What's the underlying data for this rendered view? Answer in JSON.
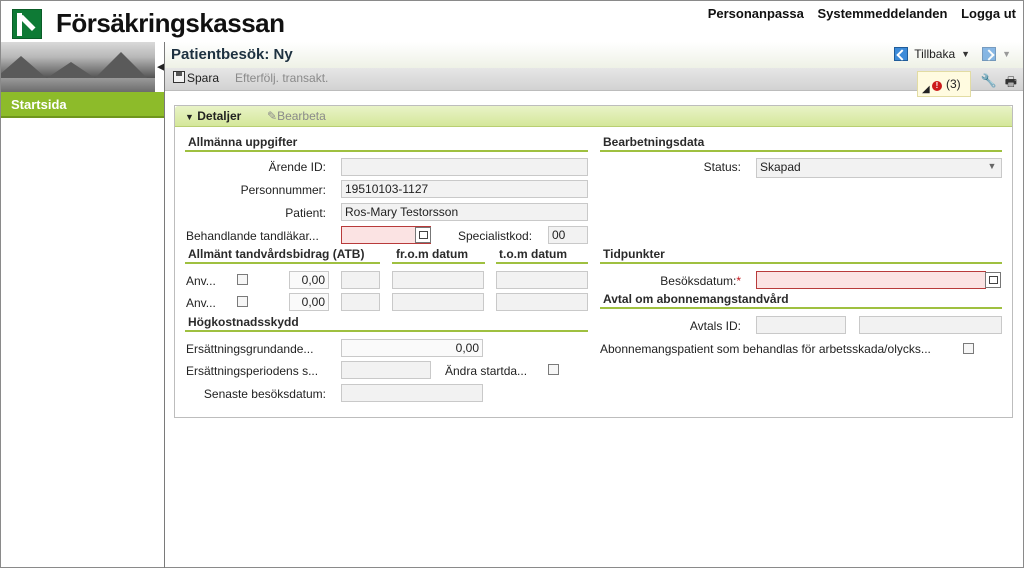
{
  "header": {
    "brand": "Försäkringskassan",
    "links": [
      "Personanpassa",
      "Systemmeddelanden",
      "Logga ut"
    ]
  },
  "sidebar": {
    "collapse_icon": "arrow-left-icon",
    "items": [
      {
        "label": "Startsida"
      }
    ]
  },
  "page": {
    "title": "Patientbesök: Ny",
    "back_label": "Tillbaka"
  },
  "toolbar": {
    "save_label": "Spara",
    "follow_label": "Efterfölj. transakt.",
    "error_count": "(3)"
  },
  "panel": {
    "details_label": "Detaljer",
    "edit_label": "Bearbeta"
  },
  "general": {
    "title": "Allmänna uppgifter",
    "case_id_label": "Ärende ID:",
    "case_id_value": "",
    "pnr_label": "Personnummer:",
    "pnr_value": "19510103-1127",
    "patient_label": "Patient:",
    "patient_value": "Ros-Mary Testorsson",
    "dentist_label": "Behandlande tandläkar...",
    "dentist_value": "",
    "specialist_label": "Specialistkod:",
    "specialist_value": "00"
  },
  "atb": {
    "title": "Allmänt tandvårdsbidrag (ATB)",
    "from_title": "fr.o.m datum",
    "to_title": "t.o.m datum",
    "rows": [
      {
        "label": "Anv...",
        "amount": "0,00"
      },
      {
        "label": "Anv...",
        "amount": "0,00"
      }
    ]
  },
  "high_cost": {
    "title": "Högkostnadsskydd",
    "basis_label": "Ersättningsgrundande...",
    "basis_value": "0,00",
    "period_label": "Ersättningsperiodens s...",
    "change_start_label": "Ändra startda...",
    "last_visit_label": "Senaste besöksdatum:"
  },
  "processing": {
    "title": "Bearbetningsdata",
    "status_label": "Status:",
    "status_value": "Skapad"
  },
  "times": {
    "title": "Tidpunkter",
    "visit_date_label": "Besöksdatum:",
    "required_mark": "*"
  },
  "subscription": {
    "title": "Avtal om abonnemangstandvård",
    "agreement_id_label": "Avtals ID:",
    "patient_label": "Abonnemangspatient som behandlas för arbetsskada/olycks..."
  }
}
